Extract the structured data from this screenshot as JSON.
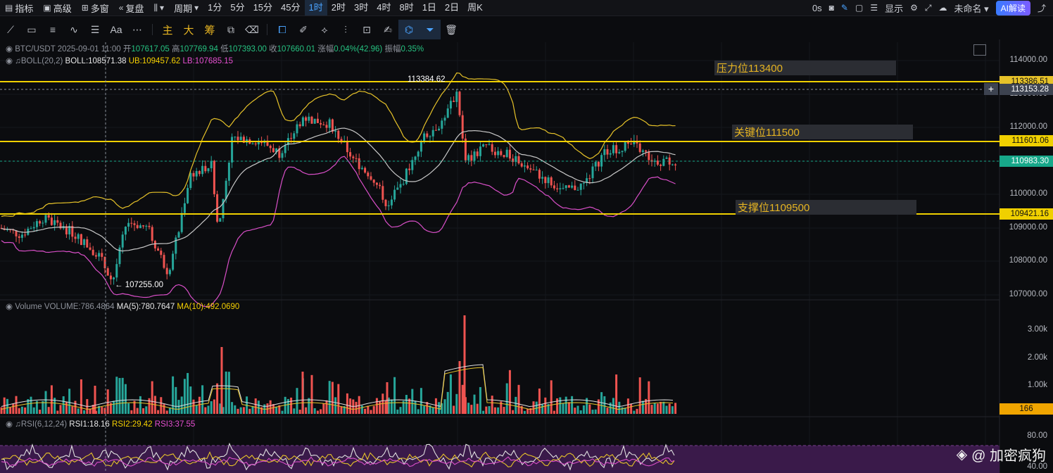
{
  "topbar": {
    "indicators": "指标",
    "advanced": "高级",
    "multiwindow": "多窗",
    "replay": "复盘",
    "period": "周期",
    "periods": [
      "1分",
      "5分",
      "15分",
      "45分",
      "1时",
      "2时",
      "3时",
      "4时",
      "8时",
      "1日",
      "2日",
      "周K"
    ],
    "active_period": "1时",
    "seconds": "0s",
    "display": "显示",
    "unnamed": "未命名",
    "ai": "AI解读"
  },
  "toolbar": {
    "main": "主",
    "big": "大",
    "chips": "筹",
    "text_tool": "Aa"
  },
  "ohlc": {
    "pair": "BTC/USDT",
    "time": "2025-09-01 11:00",
    "open_label": "开",
    "open": "107617.05",
    "high_label": "高",
    "high": "107769.94",
    "low_label": "低",
    "low": "107393.00",
    "close_label": "收",
    "close": "107660.01",
    "chg_label": "涨幅",
    "chg": "0.04%(42.96)",
    "amp_label": "振幅",
    "amp": "0.35%"
  },
  "boll": {
    "label": "BOLL(20,2)",
    "mid": "BOLL:108571.38",
    "ub": "UB:109457.62",
    "lb": "LB:107685.15"
  },
  "volume": {
    "label": "Volume",
    "value": "VOLUME:786.4864",
    "ma5": "MA(5):780.7647",
    "ma10": "MA(10):492.0690"
  },
  "rsi": {
    "label": "RSI(6,12,24)",
    "r1": "RSI1:18.16",
    "r2": "RSI2:29.42",
    "r3": "RSI3:37.55"
  },
  "price_axis": [
    "114000.00",
    "113000.00",
    "112000.00",
    "111000.00",
    "110000.00",
    "109000.00",
    "108000.00",
    "107000.00"
  ],
  "volume_axis": [
    "3.00k",
    "2.00k",
    "1.00k"
  ],
  "rsi_axis": [
    "80.00",
    "40.00"
  ],
  "tags": {
    "t1": "113386.51",
    "t2": "113153.28",
    "t3": "111601.06",
    "t4": "110983.30",
    "t5": "109421.16",
    "vol": "166"
  },
  "zones": {
    "resistance": "压力位113400",
    "key": "关键位111500",
    "support": "支撑位1109500"
  },
  "annotations": {
    "high": "113384.62",
    "low": "107255.00"
  },
  "watermark": "@ 加密疯狗",
  "colors": {
    "up": "#26a69a",
    "down": "#ef5350",
    "boll_mid": "#c8c8c8",
    "boll_ub": "#e6c229",
    "boll_lb": "#d94fc8",
    "hline": "#f0d000"
  }
}
